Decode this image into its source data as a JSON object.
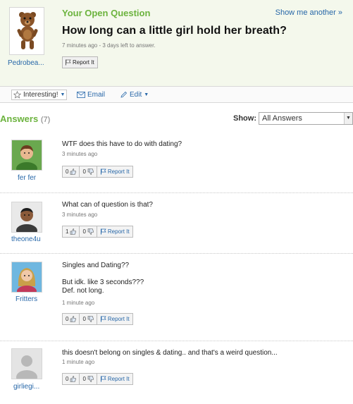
{
  "question": {
    "label": "Your Open Question",
    "show_more": "Show me another »",
    "title": "How long can a little girl hold her breath?",
    "meta": "7 minutes ago - 3 days left to answer.",
    "asker": "Pedrobea...",
    "report": "Report It"
  },
  "actions": {
    "interesting": "Interesting!",
    "email": "Email",
    "edit": "Edit"
  },
  "answers_header": {
    "title": "Answers",
    "count": "(7)",
    "show_label": "Show:",
    "show_value": "All Answers"
  },
  "answers": [
    {
      "name": "fer fer",
      "text": "WTF does this have to do with dating?",
      "time": "3 minutes ago",
      "up": "0",
      "down": "0",
      "report": "Report It"
    },
    {
      "name": "theone4u",
      "text": "What can of question is that?",
      "time": "3 minutes ago",
      "up": "1",
      "down": "0",
      "report": "Report It"
    },
    {
      "name": "Fritters",
      "text": "Singles and Dating??\n\nBut idk. like 3 seconds???\nDef. not long.",
      "time": "1 minute ago",
      "up": "0",
      "down": "0",
      "report": "Report It"
    },
    {
      "name": "girliegi...",
      "text": "this doesn't belong on singles & dating.. and that's a weird question...",
      "time": "1 minute ago",
      "up": "0",
      "down": "0",
      "report": "Report It"
    }
  ],
  "colors": {
    "accent_green": "#6cb33e",
    "link_blue": "#2767a8"
  },
  "icons": [
    "bear-avatar-icon",
    "flag-icon",
    "star-icon",
    "envelope-icon",
    "pencil-icon",
    "thumbs-up-icon",
    "thumbs-down-icon"
  ]
}
